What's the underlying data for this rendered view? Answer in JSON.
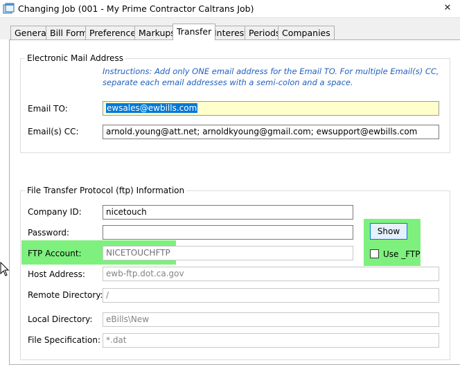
{
  "window": {
    "title": "Changing Job  (001 - My Prime Contractor Caltrans Job)",
    "close_glyph": "✕"
  },
  "tabs": [
    {
      "label": "General",
      "active": false
    },
    {
      "label": "Bill Form",
      "active": false
    },
    {
      "label": "Preferences",
      "active": false
    },
    {
      "label": "Markups",
      "active": false
    },
    {
      "label": "Transfer",
      "active": true
    },
    {
      "label": "Interest",
      "active": false
    },
    {
      "label": "Periods",
      "active": false
    },
    {
      "label": "Companies",
      "active": false
    }
  ],
  "email_section": {
    "title": "Electronic Mail Address",
    "instructions": "Instructions: Add only ONE email address for the Email TO. For multiple Email(s) CC, separate each email addresses with a semi-colon and a space.",
    "email_to_label": "Email TO:",
    "email_to_value": "ewsales@ewbills.com",
    "email_cc_label": "Email(s) CC:",
    "email_cc_value": "arnold.young@att.net; arnoldkyoung@gmail.com; ewsupport@ewbills.com"
  },
  "ftp_section": {
    "title": "File Transfer Protocol (ftp) Information",
    "company_id_label": "Company ID:",
    "company_id_value": "nicetouch",
    "password_label": "Password:",
    "password_value": "",
    "ftp_account_label": "FTP Account:",
    "ftp_account_value": "NICETOUCHFTP",
    "show_button_label": "Show",
    "use_ftp_label": "Use _FTP",
    "use_ftp_checked": false,
    "host_address_label": "Host Address:",
    "host_address_value": "ewb-ftp.dot.ca.gov",
    "remote_directory_label": "Remote Directory:",
    "remote_directory_value": "/",
    "local_directory_label": "Local Directory:",
    "local_directory_value": "eBills\\New",
    "file_spec_label": "File Specification:",
    "file_spec_value": "*.dat"
  },
  "colors": {
    "highlight": "#7ef07e",
    "instructions_text": "#1f5fbf",
    "yellow_field": "#ffffcc",
    "selection": "#0078d7"
  }
}
